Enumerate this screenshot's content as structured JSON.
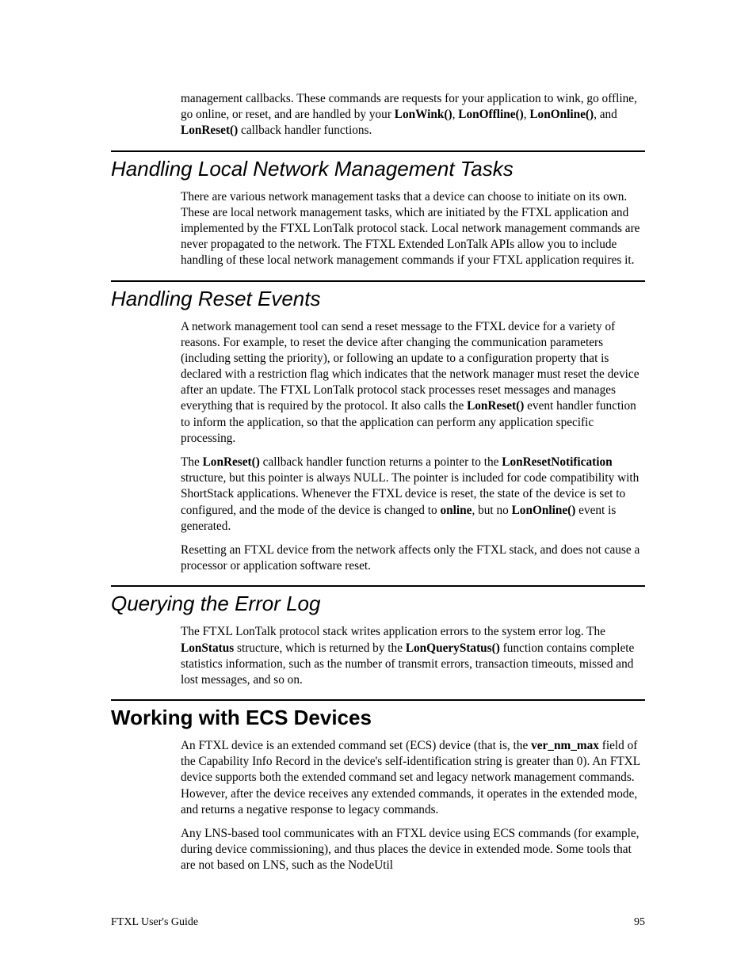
{
  "para_intro_a": "management callbacks.  These commands are requests for your application to wink, go offline, go online, or reset, and are handled by your ",
  "b_lonwink": "LonWink()",
  "sep_comma1": ", ",
  "b_lonoffline": "LonOffline()",
  "sep_comma2": ", ",
  "b_lononline": "LonOnline()",
  "sep_and": ", and ",
  "b_lonreset1": "LonReset()",
  "para_intro_b": " callback handler functions.",
  "h_local": "Handling Local Network Management Tasks",
  "para_local": "There are various network management tasks that a device can choose to initiate on its own.  These are local network management tasks, which are initiated by the FTXL application and implemented by the FTXL LonTalk protocol stack.  Local network management commands are never propagated to the network.  The FTXL Extended LonTalk APIs allow you to include handling of these local network management commands if your FTXL application requires it.",
  "h_reset": "Handling Reset Events",
  "para_reset1_a": "A network management tool can send a reset message to the FTXL device for a variety of reasons.  For example, to reset the device after changing the communication parameters (including setting the priority), or following an update to a configuration property that is declared with a restriction flag which indicates that the network manager must reset the device after an update.  The FTXL LonTalk protocol stack processes reset messages and manages everything that is required by the protocol.  It also calls the ",
  "b_lonreset2": "LonReset()",
  "para_reset1_b": " event handler function to inform the application, so that the application can perform any application specific processing.",
  "para_reset2_a": "The ",
  "b_lonreset3": "LonReset()",
  "para_reset2_b": " callback handler function returns a pointer to the ",
  "b_lonresetnotif": "LonResetNotification",
  "para_reset2_c": " structure, but this pointer is always NULL.  The pointer is included for code compatibility with ShortStack applications.  Whenever the FTXL device is reset, the state of the device is set to configured, and the mode of the device is changed to ",
  "b_online": "online",
  "para_reset2_d": ", but no ",
  "b_lononline2": "LonOnline()",
  "para_reset2_e": " event is generated.",
  "para_reset3": "Resetting an FTXL device from the network affects only the FTXL stack, and does not cause a processor or application software reset.",
  "h_error": "Querying the Error Log",
  "para_error_a": "The FTXL LonTalk protocol stack writes application errors to the system error log.  The ",
  "b_lonstatus": "LonStatus",
  "para_error_b": " structure, which is returned by the ",
  "b_lonquery": "LonQueryStatus()",
  "para_error_c": " function contains complete statistics information, such as the number of transmit errors, transaction timeouts, missed and lost messages, and so on.",
  "h_ecs": "Working with ECS Devices",
  "para_ecs1_a": "An FTXL device is an extended command set (ECS) device (that is, the ",
  "b_ver": "ver_nm_max",
  "para_ecs1_b": " field of the Capability Info Record in the device's self-identification string is greater than 0).  An FTXL device supports both the extended command set and legacy network management commands.  However, after the device receives any extended commands, it operates in the extended mode, and returns a negative response to legacy commands.",
  "para_ecs2": "Any LNS-based tool communicates with an FTXL device using ECS commands (for example, during device commissioning), and thus places the device in extended mode.  Some tools that are not based on LNS, such as the NodeUtil",
  "footer_left": "FTXL User's Guide",
  "footer_right": "95"
}
